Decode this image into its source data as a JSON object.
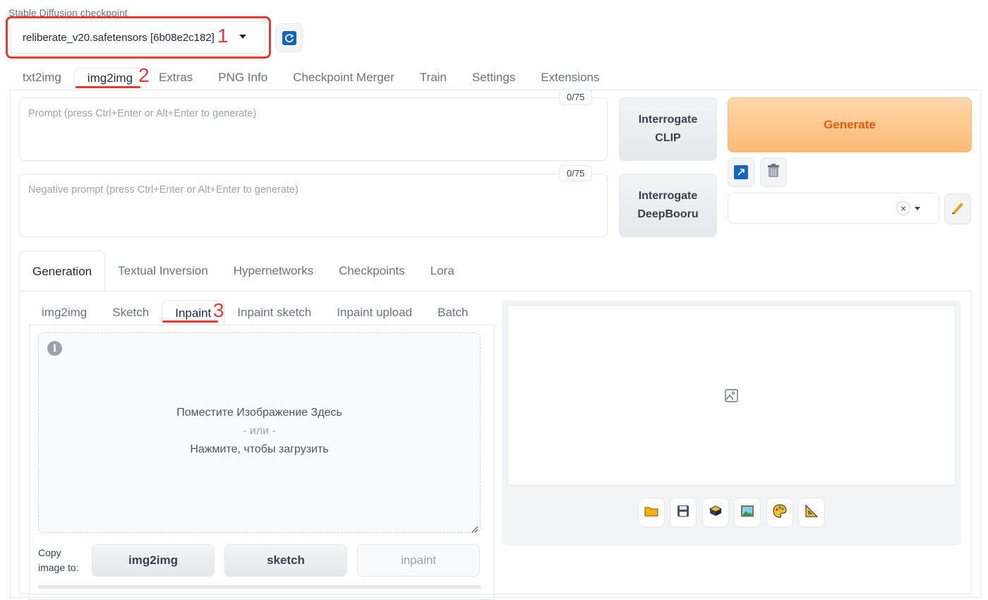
{
  "checkpoint": {
    "label": "Stable Diffusion checkpoint",
    "value": "reliberate_v20.safetensors [6b08e2c182]"
  },
  "annotations": [
    "1",
    "2",
    "3"
  ],
  "top_tabs": [
    "txt2img",
    "img2img",
    "Extras",
    "PNG Info",
    "Checkpoint Merger",
    "Train",
    "Settings",
    "Extensions"
  ],
  "prompt": {
    "placeholder": "Prompt (press Ctrl+Enter or Alt+Enter to generate)",
    "counter": "0/75"
  },
  "negative_prompt": {
    "placeholder": "Negative prompt (press Ctrl+Enter or Alt+Enter to generate)",
    "counter": "0/75"
  },
  "buttons": {
    "interrogate_clip": "Interrogate CLIP",
    "interrogate_deepbooru": "Interrogate DeepBooru",
    "generate": "Generate",
    "clear_style": "×"
  },
  "gen_tabs": [
    "Generation",
    "Textual Inversion",
    "Hypernetworks",
    "Checkpoints",
    "Lora"
  ],
  "sub_tabs": [
    "img2img",
    "Sketch",
    "Inpaint",
    "Inpaint sketch",
    "Inpaint upload",
    "Batch"
  ],
  "drop_zone": {
    "line1": "Поместите Изображение Здесь",
    "line2": "- или -",
    "line3": "Нажмите, чтобы загрузить"
  },
  "copy": {
    "label_line1": "Copy",
    "label_line2": "image to:",
    "buttons": [
      "img2img",
      "sketch",
      "inpaint"
    ]
  },
  "colors": {
    "annotation": "#e53935",
    "generate_bg": "#fdba74",
    "generate_text": "#ea580c"
  }
}
